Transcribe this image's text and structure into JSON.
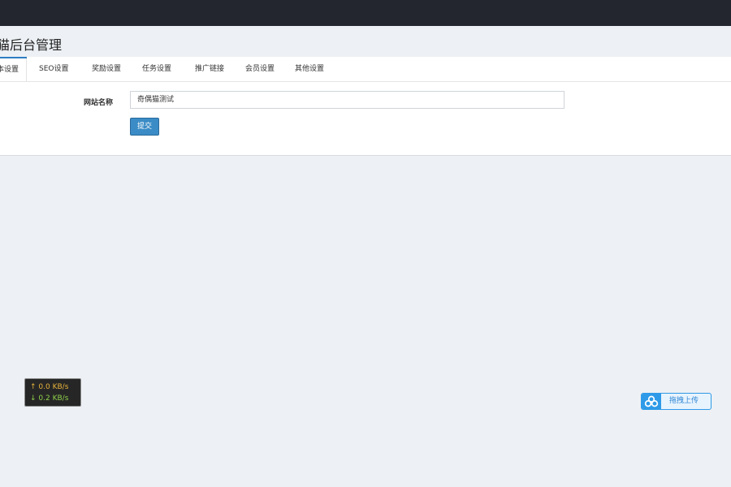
{
  "header": {
    "title": "猫后台管理"
  },
  "tabs": [
    {
      "label": "本设置",
      "active": true
    },
    {
      "label": "SEO设置",
      "active": false
    },
    {
      "label": "奖励设置",
      "active": false
    },
    {
      "label": "任务设置",
      "active": false
    },
    {
      "label": "推广链接",
      "active": false
    },
    {
      "label": "会员设置",
      "active": false
    },
    {
      "label": "其他设置",
      "active": false
    }
  ],
  "form": {
    "site_name_label": "网站名称",
    "site_name_value": "奇偶猫测试",
    "submit_label": "提交"
  },
  "speed": {
    "up": "0.0 KB/s",
    "down": "0.2 KB/s"
  },
  "upload": {
    "label": "拖拽上传"
  },
  "colors": {
    "topbar": "#23262e",
    "accent": "#2f7ec2",
    "button": "#3b8cc6",
    "upload": "#2e9ae8"
  }
}
